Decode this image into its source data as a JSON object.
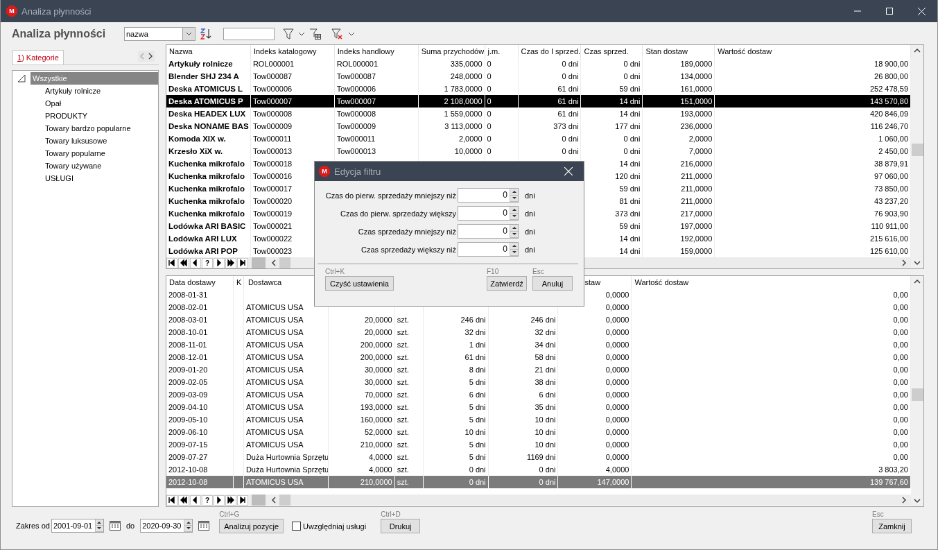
{
  "window": {
    "logo": "M",
    "title": "Analiza płynności"
  },
  "heading": "Analiza płynności",
  "toolbar": {
    "sort_field": "nazwa"
  },
  "side_tab": {
    "hotkey": "1",
    "label": ") Kategorie",
    "selected": true
  },
  "tree": [
    {
      "label": "Wszystkie",
      "selected": true,
      "expanded": true,
      "children": [
        {
          "label": "Artykuły rolnicze",
          "selected": false
        },
        {
          "label": "Opał",
          "selected": false
        },
        {
          "label": "PRODUKTY",
          "selected": false
        },
        {
          "label": "Towary bardzo popularne",
          "selected": false
        },
        {
          "label": "Towary luksusowe",
          "selected": false
        },
        {
          "label": "Towary popularne",
          "selected": false
        },
        {
          "label": "Towary używane",
          "selected": false
        },
        {
          "label": "USŁUGI",
          "selected": false
        }
      ]
    }
  ],
  "products_table": {
    "columns": [
      {
        "label": "Nazwa"
      },
      {
        "label": "Indeks katalogowy"
      },
      {
        "label": "Indeks handlowy"
      },
      {
        "label": "Suma przychodów"
      },
      {
        "label": "j.m."
      },
      {
        "label": "Czas do I sprzed."
      },
      {
        "label": "Czas sprzed."
      },
      {
        "label": "Stan dostaw"
      },
      {
        "label": "Wartość dostaw"
      }
    ],
    "rows": [
      {
        "selected": false,
        "name": "Artykuły rolnicze",
        "catalog_index": "ROL000001",
        "trade_index": "ROL000001",
        "revenue": "335,0000",
        "unit": "0",
        "first_sale_time": "0 dni",
        "sale_time": "0 dni",
        "stock": "189,0000",
        "value": "18 900,00"
      },
      {
        "selected": false,
        "name": "Blender SHJ 234 A",
        "catalog_index": "Tow000087",
        "trade_index": "Tow000087",
        "revenue": "248,0000",
        "unit": "0",
        "first_sale_time": "0 dni",
        "sale_time": "0 dni",
        "stock": "134,0000",
        "value": "26 800,00"
      },
      {
        "selected": false,
        "name": "Deska ATOMICUS L",
        "catalog_index": "Tow000006",
        "trade_index": "Tow000006",
        "revenue": "1 783,0000",
        "unit": "0",
        "first_sale_time": "61 dni",
        "sale_time": "59 dni",
        "stock": "161,0000",
        "value": "252 478,59"
      },
      {
        "selected": true,
        "name": "Deska ATOMICUS P",
        "catalog_index": "Tow000007",
        "trade_index": "Tow000007",
        "revenue": "2 108,0000",
        "unit": "0",
        "first_sale_time": "61 dni",
        "sale_time": "14 dni",
        "stock": "151,0000",
        "value": "143 570,80"
      },
      {
        "selected": false,
        "name": "Deska HEADEX LUX",
        "catalog_index": "Tow000008",
        "trade_index": "Tow000008",
        "revenue": "1 559,0000",
        "unit": "0",
        "first_sale_time": "61 dni",
        "sale_time": "14 dni",
        "stock": "193,0000",
        "value": "420 846,09"
      },
      {
        "selected": false,
        "name": "Deska NONAME BAS",
        "catalog_index": "Tow000009",
        "trade_index": "Tow000009",
        "revenue": "3 113,0000",
        "unit": "0",
        "first_sale_time": "373 dni",
        "sale_time": "177 dni",
        "stock": "236,0000",
        "value": "116 246,70"
      },
      {
        "selected": false,
        "name": "Komoda XIX w.",
        "catalog_index": "Tow000011",
        "trade_index": "Tow000011",
        "revenue": "2,0000",
        "unit": "0",
        "first_sale_time": "0 dni",
        "sale_time": "0 dni",
        "stock": "2,0000",
        "value": "1 060,00"
      },
      {
        "selected": false,
        "name": "Krzesło XiX w.",
        "catalog_index": "Tow000013",
        "trade_index": "Tow000013",
        "revenue": "10,0000",
        "unit": "0",
        "first_sale_time": "0 dni",
        "sale_time": "0 dni",
        "stock": "7,0000",
        "value": "2 450,00"
      },
      {
        "selected": false,
        "name": "Kuchenka mikrofalo",
        "catalog_index": "Tow000018",
        "sale_time": "14 dni",
        "stock": "216,0000",
        "value": "38 879,91"
      },
      {
        "selected": false,
        "name": "Kuchenka mikrofalo",
        "catalog_index": "Tow000016",
        "sale_time": "120 dni",
        "stock": "211,0000",
        "value": "97 060,00"
      },
      {
        "selected": false,
        "name": "Kuchenka mikrofalo",
        "catalog_index": "Tow000017",
        "sale_time": "59 dni",
        "stock": "211,0000",
        "value": "73 850,00"
      },
      {
        "selected": false,
        "name": "Kuchenka mikrofalo",
        "catalog_index": "Tow000020",
        "sale_time": "81 dni",
        "stock": "211,0000",
        "value": "43 237,20"
      },
      {
        "selected": false,
        "name": "Kuchenka mikrofalo",
        "catalog_index": "Tow000019",
        "sale_time": "373 dni",
        "stock": "217,0000",
        "value": "76 903,90"
      },
      {
        "selected": false,
        "name": "Lodówka ARI BASIC",
        "catalog_index": "Tow000021",
        "sale_time": "59 dni",
        "stock": "197,0000",
        "value": "110 911,00"
      },
      {
        "selected": false,
        "name": "Lodówka ARI LUX",
        "catalog_index": "Tow000022",
        "sale_time": "14 dni",
        "stock": "192,0000",
        "value": "215 616,00"
      },
      {
        "selected": false,
        "name": "Lodówka ARI POP",
        "catalog_index": "Tow000023",
        "sale_time": "14 dni",
        "stock": "159,0000",
        "value": "125 610,00"
      }
    ],
    "nav_help": "?"
  },
  "deliveries_table": {
    "columns": [
      {
        "label": "Data dostawy"
      },
      {
        "label": "K"
      },
      {
        "label": "Dostawca"
      },
      {},
      {},
      {},
      {},
      {
        "label": "staw"
      },
      {
        "label": "Wartość dostaw"
      }
    ],
    "rows": [
      {
        "selected": false,
        "date": "2008-01-31",
        "stock": "0,0000",
        "value": "0,00"
      },
      {
        "selected": false,
        "date": "2008-02-01",
        "supplier": "ATOMICUS USA",
        "stock": "0,0000",
        "value": "0,00"
      },
      {
        "selected": false,
        "date": "2008-03-01",
        "supplier": "ATOMICUS USA",
        "quantity": "20,0000",
        "unit": "szt.",
        "first_sale_time": "246 dni",
        "sale_time": "246 dni",
        "stock": "0,0000",
        "value": "0,00"
      },
      {
        "selected": false,
        "date": "2008-10-01",
        "supplier": "ATOMICUS USA",
        "quantity": "20,0000",
        "unit": "szt.",
        "first_sale_time": "32 dni",
        "sale_time": "32 dni",
        "stock": "0,0000",
        "value": "0,00"
      },
      {
        "selected": false,
        "date": "2008-11-01",
        "supplier": "ATOMICUS USA",
        "quantity": "200,0000",
        "unit": "szt.",
        "first_sale_time": "1 dni",
        "sale_time": "34 dni",
        "stock": "0,0000",
        "value": "0,00"
      },
      {
        "selected": false,
        "date": "2008-12-01",
        "supplier": "ATOMICUS USA",
        "quantity": "200,0000",
        "unit": "szt.",
        "first_sale_time": "61 dni",
        "sale_time": "58 dni",
        "stock": "0,0000",
        "value": "0,00"
      },
      {
        "selected": false,
        "date": "2009-01-20",
        "supplier": "ATOMICUS USA",
        "quantity": "30,0000",
        "unit": "szt.",
        "first_sale_time": "8 dni",
        "sale_time": "21 dni",
        "stock": "0,0000",
        "value": "0,00"
      },
      {
        "selected": false,
        "date": "2009-02-05",
        "supplier": "ATOMICUS USA",
        "quantity": "30,0000",
        "unit": "szt.",
        "first_sale_time": "5 dni",
        "sale_time": "38 dni",
        "stock": "0,0000",
        "value": "0,00"
      },
      {
        "selected": false,
        "date": "2009-03-09",
        "supplier": "ATOMICUS USA",
        "quantity": "70,0000",
        "unit": "szt.",
        "first_sale_time": "6 dni",
        "sale_time": "6 dni",
        "stock": "0,0000",
        "value": "0,00"
      },
      {
        "selected": false,
        "date": "2009-04-10",
        "supplier": "ATOMICUS USA",
        "quantity": "193,0000",
        "unit": "szt.",
        "first_sale_time": "5 dni",
        "sale_time": "35 dni",
        "stock": "0,0000",
        "value": "0,00"
      },
      {
        "selected": false,
        "date": "2009-05-10",
        "supplier": "ATOMICUS USA",
        "quantity": "160,0000",
        "unit": "szt.",
        "first_sale_time": "5 dni",
        "sale_time": "10 dni",
        "stock": "0,0000",
        "value": "0,00"
      },
      {
        "selected": false,
        "date": "2009-06-10",
        "supplier": "ATOMICUS USA",
        "quantity": "52,0000",
        "unit": "szt.",
        "first_sale_time": "10 dni",
        "sale_time": "10 dni",
        "stock": "0,0000",
        "value": "0,00"
      },
      {
        "selected": false,
        "date": "2009-07-15",
        "supplier": "ATOMICUS USA",
        "quantity": "210,0000",
        "unit": "szt.",
        "first_sale_time": "5 dni",
        "sale_time": "10 dni",
        "stock": "0,0000",
        "value": "0,00"
      },
      {
        "selected": false,
        "date": "2009-07-27",
        "supplier": "Duża Hurtownia Sprzętu",
        "quantity": "4,0000",
        "unit": "szt.",
        "first_sale_time": "5 dni",
        "sale_time": "1169 dni",
        "stock": "0,0000",
        "value": "0,00"
      },
      {
        "selected": false,
        "date": "2012-10-08",
        "supplier": "Duża Hurtownia Sprzętu",
        "quantity": "4,0000",
        "unit": "szt.",
        "first_sale_time": "0 dni",
        "sale_time": "0 dni",
        "stock": "4,0000",
        "value": "3 803,20"
      },
      {
        "selected": true,
        "date": "2012-10-08",
        "supplier": "ATOMICUS USA",
        "quantity": "210,0000",
        "unit": "szt.",
        "first_sale_time": "0 dni",
        "sale_time": "0 dni",
        "stock": "147,0000",
        "value": "139 767,60"
      }
    ],
    "nav_help": "?"
  },
  "footer": {
    "range_label": "Zakres od",
    "date_from": "2001-09-01",
    "to_label": "do",
    "date_to": "2020-09-30",
    "analyze": {
      "shortcut": "Ctrl+G",
      "label": "Analizuj pozycje"
    },
    "include_services": {
      "label": "Uwzględniaj usługi",
      "checked": false
    },
    "print": {
      "shortcut": "Ctrl+D",
      "label": "Drukuj"
    },
    "close": {
      "shortcut": "Esc",
      "label": "Zamknij"
    }
  },
  "filter_dialog": {
    "logo": "M",
    "title": "Edycja filtru",
    "fields": [
      {
        "label": "Czas do pierw. sprzedaży mniejszy niż",
        "value": "0",
        "unit": "dni"
      },
      {
        "label": "Czas do pierw. sprzedaży większy",
        "value": "0",
        "unit": "dni"
      },
      {
        "label": "Czas sprzedaży mniejszy niż",
        "value": "0",
        "unit": "dni"
      },
      {
        "label": "Czas sprzedaży większy niż",
        "value": "0",
        "unit": "dni"
      }
    ],
    "clear": {
      "shortcut": "Ctrl+K",
      "label": "Czyść ustawienia"
    },
    "confirm": {
      "shortcut": "F10",
      "label": "Zatwierdź"
    },
    "cancel": {
      "shortcut": "Esc",
      "label": "Anuluj"
    }
  }
}
